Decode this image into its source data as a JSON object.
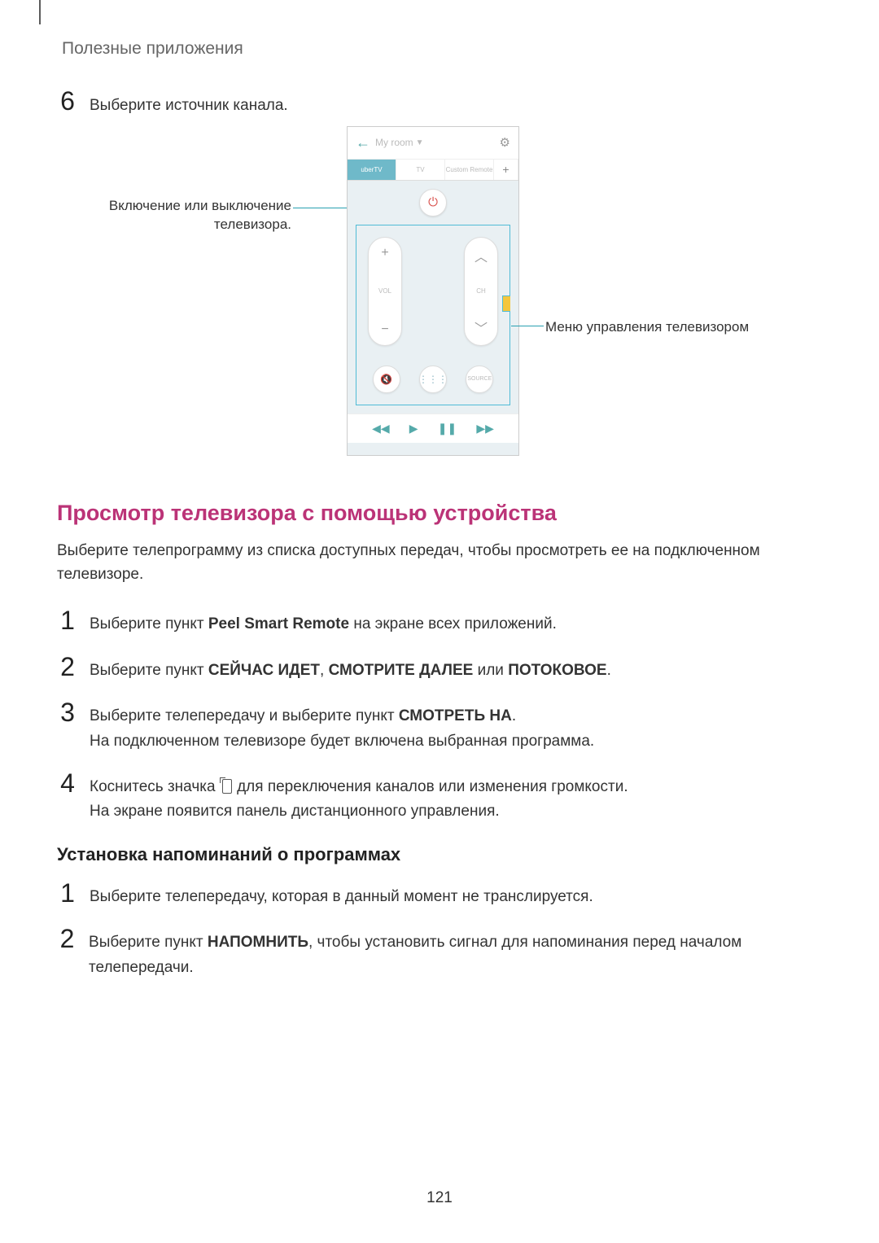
{
  "header": {
    "title": "Полезные приложения"
  },
  "step6": {
    "num": "6",
    "text": "Выберите источник канала."
  },
  "figure": {
    "callout_left": "Включение или выключение телевизора.",
    "callout_right": "Меню управления телевизором",
    "phone": {
      "room_label": "My room",
      "tabs": {
        "active": "uberTV",
        "t2": "TV",
        "t3": "Custom\nRemote"
      },
      "vol_label": "VOL",
      "ch_label": "CH",
      "source_label": "SOURCE"
    }
  },
  "section1": {
    "title": "Просмотр телевизора с помощью устройства",
    "intro": "Выберите телепрограмму из списка доступных передач, чтобы просмотреть ее на подключенном телевизоре.",
    "s1_pre": "Выберите пункт ",
    "s1_bold": "Peel Smart Remote",
    "s1_post": " на экране всех приложений.",
    "s2_pre": "Выберите пункт ",
    "s2_b1": "СЕЙЧАС ИДЕТ",
    "s2_mid1": ", ",
    "s2_b2": "СМОТРИТЕ ДАЛЕЕ",
    "s2_mid2": " или ",
    "s2_b3": "ПОТОКОВОЕ",
    "s2_post": ".",
    "s3_line1_pre": "Выберите телепередачу и выберите пункт ",
    "s3_line1_bold": "СМОТРЕТЬ НА",
    "s3_line1_post": ".",
    "s3_line2": "На подключенном телевизоре будет включена выбранная программа.",
    "s4_line1_pre": "Коснитесь значка ",
    "s4_line1_post": " для переключения каналов или изменения громкости.",
    "s4_line2": "На экране появится панель дистанционного управления."
  },
  "section2": {
    "title": "Установка напоминаний о программах",
    "s1": "Выберите телепередачу, которая в данный момент не транслируется.",
    "s2_pre": "Выберите пункт ",
    "s2_bold": "НАПОМНИТЬ",
    "s2_post": ", чтобы установить сигнал для напоминания перед началом телепередачи."
  },
  "page_number": "121"
}
